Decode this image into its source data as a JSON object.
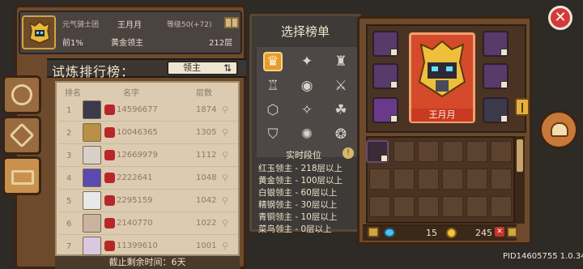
{
  "player": {
    "guild": "元气骑士团",
    "name": "王月月",
    "level": "等级50(+72)",
    "percent": "前1%",
    "title": "黄金领主",
    "floor": "212层"
  },
  "board": {
    "title": "试炼排行榜：",
    "selected": "领主"
  },
  "columns": {
    "rank": "排名",
    "name": "名字",
    "floor": "层数"
  },
  "rows": [
    {
      "rank": "1",
      "name": "14596677",
      "floor": "1874"
    },
    {
      "rank": "2",
      "name": "10046365",
      "floor": "1305"
    },
    {
      "rank": "3",
      "name": "12669979",
      "floor": "1112"
    },
    {
      "rank": "4",
      "name": "2222641",
      "floor": "1048"
    },
    {
      "rank": "5",
      "name": "2295159",
      "floor": "1042"
    },
    {
      "rank": "6",
      "name": "2140770",
      "floor": "1022"
    },
    {
      "rank": "7",
      "name": "11399610",
      "floor": "1001"
    }
  ],
  "countdown": "截止剩余时间：6天",
  "selection": {
    "title": "选择榜单",
    "icons": [
      "class-icon-1",
      "class-icon-2",
      "class-icon-3",
      "class-icon-4",
      "class-icon-5",
      "class-icon-6",
      "class-icon-7",
      "class-icon-8",
      "class-icon-9",
      "class-icon-10",
      "class-icon-11",
      "class-icon-12"
    ],
    "realtime_label": "实时段位",
    "tiers": [
      "红玉领主 - 218层以上",
      "黄金领主 - 100层以上",
      "白银领主 - 60层以上",
      "精钢领主 - 30层以上",
      "青铜领主 - 10层以上",
      "菜鸟领主 - 0层以上"
    ]
  },
  "hero": {
    "name": "王月月"
  },
  "currency": {
    "gems": "15",
    "coins": "245"
  },
  "footer": {
    "pid": "PID14605755 1.0.34"
  },
  "colors": {
    "accent": "#e89a2a",
    "hero_card": "#d44a2a",
    "badge": "#b8262a"
  }
}
